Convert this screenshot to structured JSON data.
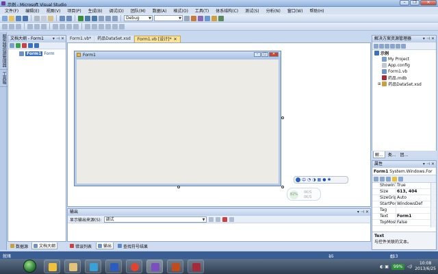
{
  "window": {
    "title": "示例 - Microsoft Visual Studio"
  },
  "menu": [
    "文件(F)",
    "编辑(E)",
    "视图(V)",
    "项目(P)",
    "生成(B)",
    "调试(D)",
    "团队(M)",
    "数据(A)",
    "格式(O)",
    "工具(T)",
    "体系结构(C)",
    "测试(S)",
    "分析(N)",
    "窗口(W)",
    "帮助(H)"
  ],
  "toolbar": {
    "config_combo": "Debug"
  },
  "doc_outline": {
    "title": "文档大纲 - Form1",
    "item_name": "Form1",
    "item_kind": "Form",
    "tabs": [
      "数据源",
      "文档大纲"
    ]
  },
  "left_strip": [
    "服务器资源管理器",
    "工具箱"
  ],
  "doc_tabs": [
    {
      "label": "Form1.vb*",
      "active": false
    },
    {
      "label": "药品DataSet.xsd",
      "active": false
    },
    {
      "label": "Form1.vb [设计]*",
      "active": true
    }
  ],
  "form": {
    "title": "Form1"
  },
  "ime": {
    "label": "中"
  },
  "net": {
    "percent": "82%",
    "up": "0K/S",
    "down": "0K/S"
  },
  "output": {
    "title": "输出",
    "source_label": "显示输出来源(S):",
    "source_value": "调试",
    "tabs": [
      "错误列表",
      "输出",
      "查找符号结果"
    ]
  },
  "solution": {
    "title": "解决方案资源管理器",
    "project": "示例",
    "items": [
      "My Project",
      "App.config",
      "Form1.vb",
      "药品.mdb",
      "药品DataSet.xsd"
    ],
    "tabs": [
      "解...",
      "类...",
      "团..."
    ]
  },
  "properties": {
    "title": "属性",
    "object_name": "Form1",
    "object_type": "System.Windows.For",
    "rows": [
      {
        "name": "ShowInTas",
        "value": "True",
        "bold": false
      },
      {
        "name": "Size",
        "value": "613, 404",
        "bold": true
      },
      {
        "name": "SizeGripSty",
        "value": "Auto",
        "bold": false
      },
      {
        "name": "StartPositic",
        "value": "WindowsDef",
        "bold": false
      },
      {
        "name": "Tag",
        "value": "",
        "bold": false
      },
      {
        "name": "Text",
        "value": "Form1",
        "bold": true
      },
      {
        "name": "TopMost",
        "value": "False",
        "bold": false
      }
    ],
    "desc_title": "Text",
    "desc_text": "与控件关联的文本。"
  },
  "status": {
    "left": "就绪",
    "pos": "15 , 15",
    "size": "613 × 404"
  },
  "taskbar": {
    "battery": "99%",
    "time": "10:08",
    "date": "2013/6/25",
    "apps": [
      {
        "name": "ie-icon",
        "color": "#f0c13c"
      },
      {
        "name": "explorer-icon",
        "color": "#e3c27a"
      },
      {
        "name": "media-icon",
        "color": "#3aa0d8"
      },
      {
        "name": "word-icon",
        "color": "#2b5cbf"
      },
      {
        "name": "chrome-icon",
        "color": "#e0432f"
      },
      {
        "name": "vs-icon",
        "color": "#7a4fbf"
      },
      {
        "name": "ppt-icon",
        "color": "#c24b1d"
      },
      {
        "name": "access-icon",
        "color": "#a72a3a"
      }
    ]
  }
}
